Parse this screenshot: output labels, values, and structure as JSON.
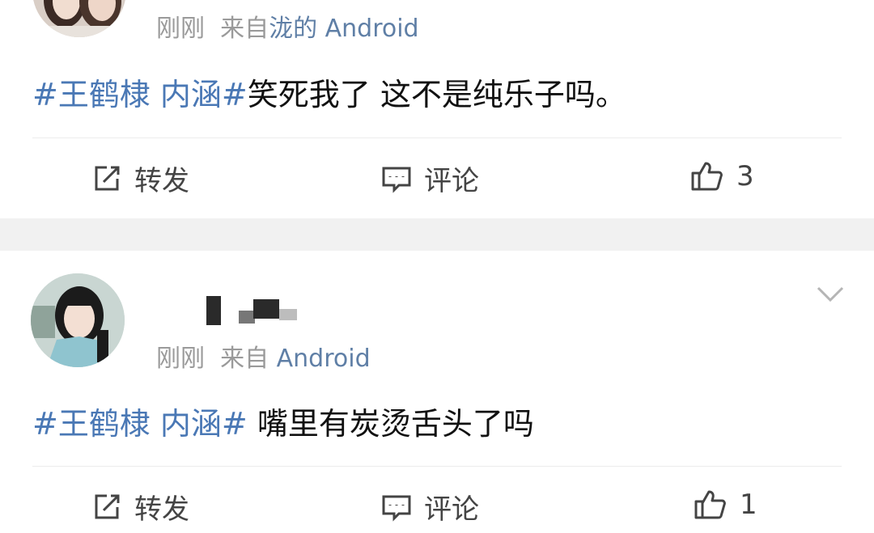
{
  "posts": [
    {
      "meta": {
        "time": "刚刚",
        "source": "来自",
        "device": "泷的 Android"
      },
      "content": {
        "hashtag": "#王鹤棣 内涵#",
        "text": "笑死我了 这不是纯乐子吗。"
      },
      "actions": {
        "repost": "转发",
        "comment": "评论",
        "likes": "3"
      }
    },
    {
      "meta": {
        "time": "刚刚",
        "source": "来自",
        "device": "Android"
      },
      "content": {
        "hashtag": "#王鹤棣 内涵#",
        "text": " 嘴里有炭烫舌头了吗"
      },
      "actions": {
        "repost": "转发",
        "comment": "评论",
        "likes": "1"
      }
    }
  ],
  "colors": {
    "link": "#4a78b5",
    "meta": "#9a9a9a",
    "separator": "#f1f1f1"
  }
}
